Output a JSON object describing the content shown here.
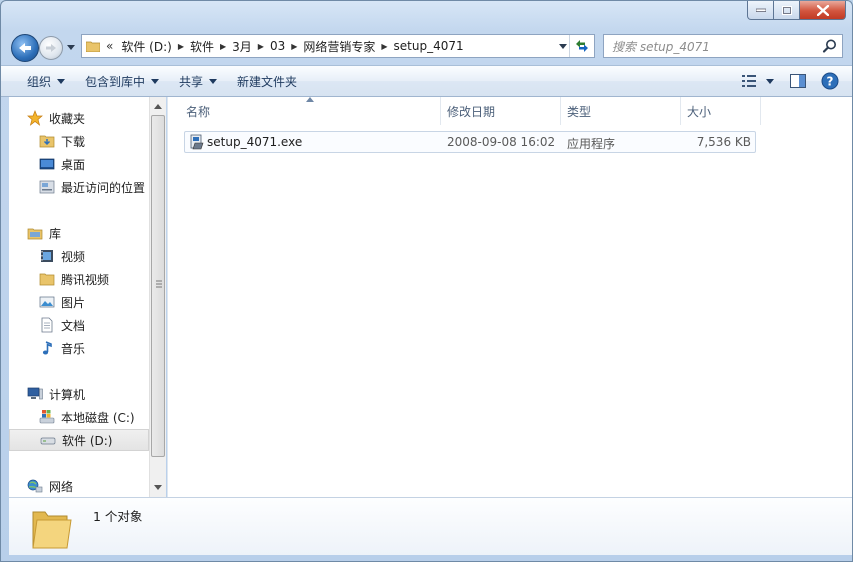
{
  "address": {
    "overflow_label": "«",
    "crumbs": [
      "软件 (D:)",
      "软件",
      "3月",
      "03",
      "网络营销专家",
      "setup_4071"
    ]
  },
  "search": {
    "placeholder": "搜索 setup_4071"
  },
  "toolbar": {
    "organize": "组织",
    "include_in_library": "包含到库中",
    "share": "共享",
    "new_folder": "新建文件夹"
  },
  "sidebar": {
    "favorites": {
      "label": "收藏夹",
      "items": [
        "下载",
        "桌面",
        "最近访问的位置"
      ]
    },
    "libraries": {
      "label": "库",
      "items": [
        "视频",
        "腾讯视频",
        "图片",
        "文档",
        "音乐"
      ]
    },
    "computer": {
      "label": "计算机",
      "items": [
        "本地磁盘 (C:)",
        "软件 (D:)"
      ]
    },
    "network": {
      "label": "网络"
    }
  },
  "columns": {
    "name": "名称",
    "modified": "修改日期",
    "type": "类型",
    "size": "大小"
  },
  "files": [
    {
      "name": "setup_4071.exe",
      "modified": "2008-09-08 16:02",
      "type": "应用程序",
      "size": "7,536 KB"
    }
  ],
  "status": {
    "count_text": "1 个对象"
  },
  "colors": {
    "accent": "#2d6fb9",
    "selection_border": "#c8d5e5",
    "window_frame": "#b8cfea"
  }
}
